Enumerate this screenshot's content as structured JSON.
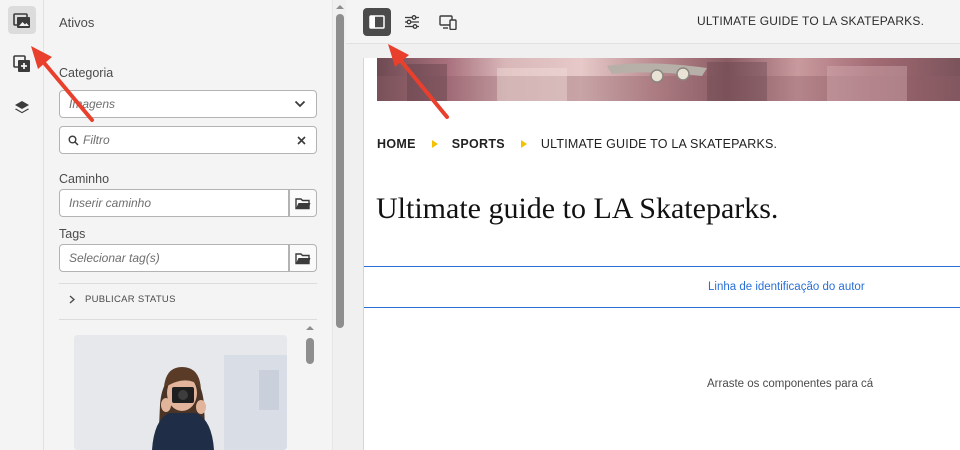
{
  "rail": {
    "items": [
      {
        "name": "assets",
        "icon": "asset-browser-icon",
        "active": true
      },
      {
        "name": "components",
        "icon": "add-component-icon",
        "active": false
      },
      {
        "name": "content-tree",
        "icon": "layers-icon",
        "active": false
      }
    ]
  },
  "panel": {
    "title": "Ativos",
    "category": {
      "label": "Categoria",
      "value": "Imagens"
    },
    "filter": {
      "placeholder": "Filtro"
    },
    "path": {
      "label": "Caminho",
      "placeholder": "Inserir caminho"
    },
    "tags": {
      "label": "Tags",
      "placeholder": "Selecionar tag(s)"
    },
    "publish_status": "PUBLICAR STATUS"
  },
  "toolbar": {
    "buttons": [
      {
        "name": "side-panel-toggle",
        "icon": "side-panel-icon",
        "active": true
      },
      {
        "name": "page-properties",
        "icon": "sliders-icon",
        "active": false
      },
      {
        "name": "emulator",
        "icon": "devices-icon",
        "active": false
      }
    ],
    "page_name": "ULTIMATE GUIDE TO LA SKATEPARKS."
  },
  "page": {
    "breadcrumb": [
      "HOME",
      "SPORTS",
      "ULTIMATE GUIDE TO LA SKATEPARKS."
    ],
    "title": "Ultimate guide to LA Skateparks.",
    "byline": "Linha de identificação do autor",
    "drop_hint": "Arraste os componentes para cá"
  },
  "colors": {
    "accent_blue": "#2a6fd6",
    "breadcrumb_separator": "#f2c200",
    "annotation_arrow": "#e8402c",
    "toolbar_active": "#4b4b4b"
  }
}
